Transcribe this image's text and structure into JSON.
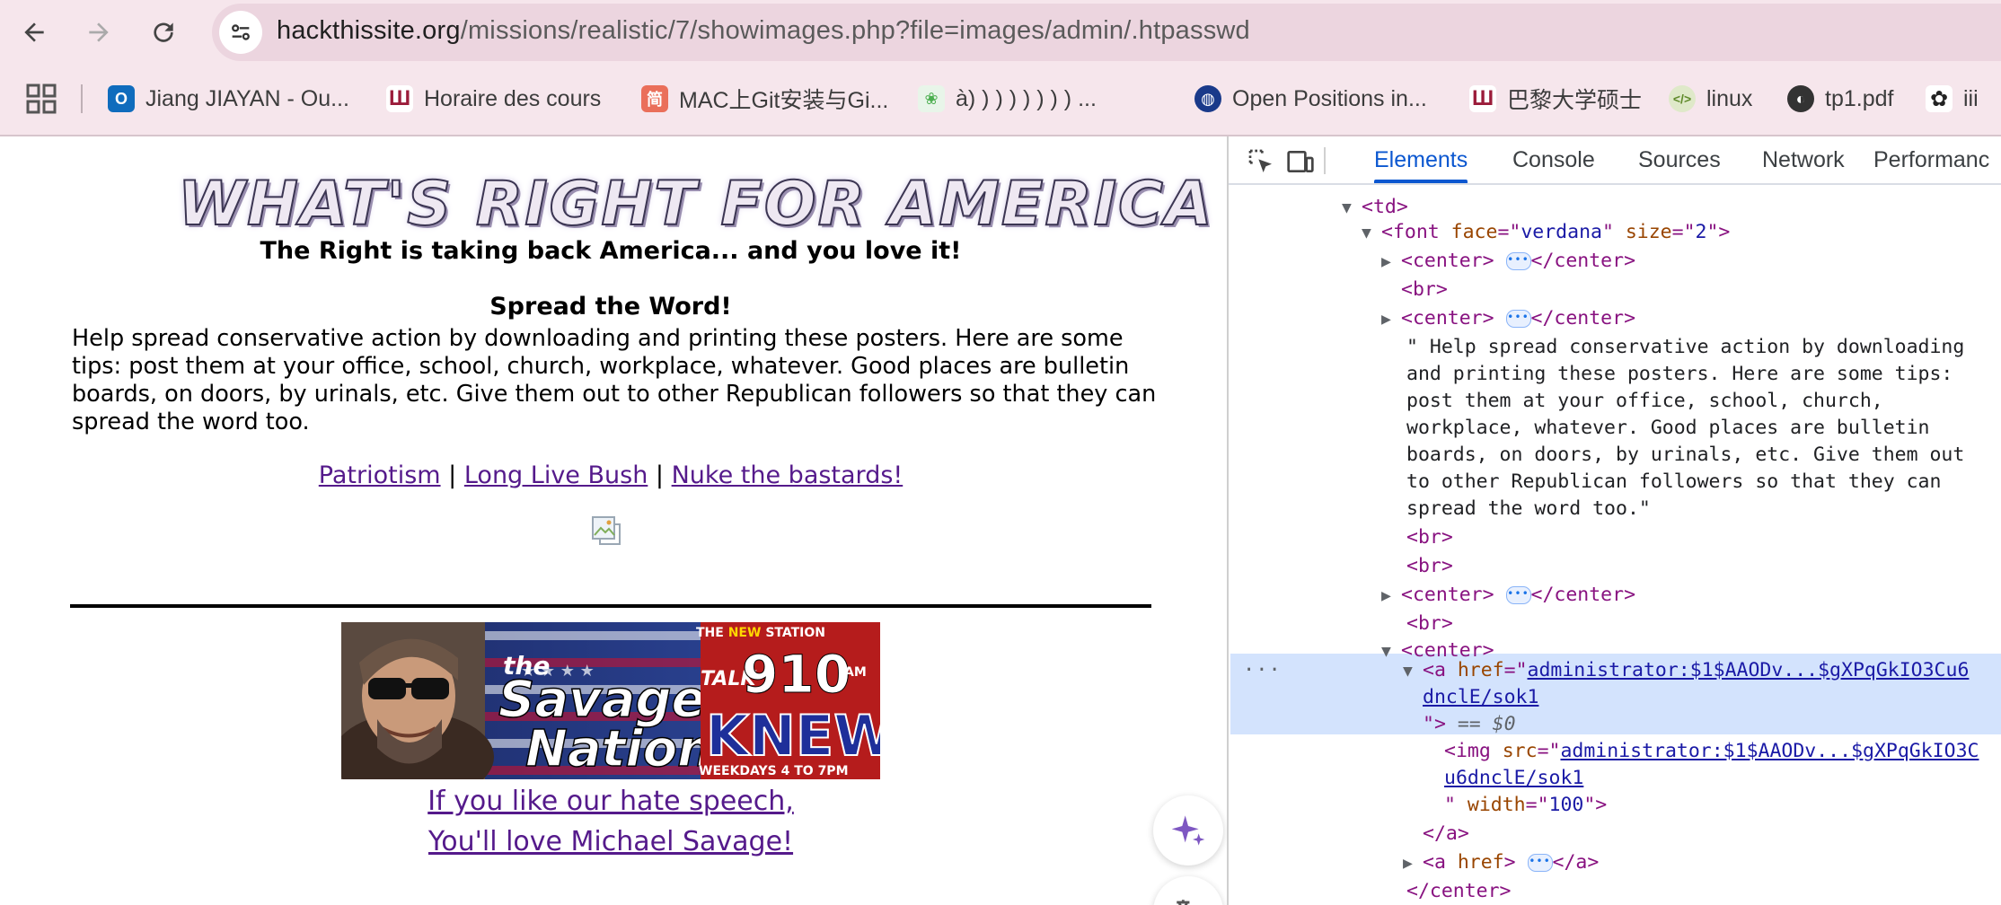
{
  "browser": {
    "url_host": "hackthissite.org",
    "url_path": "/missions/realistic/7/showimages.php?file=images/admin/.htpasswd",
    "bookmarks": [
      {
        "label": "Jiang JIAYAN - Ou...",
        "icon": "outlook-icon",
        "color": "#0f6cbd"
      },
      {
        "label": "Horaire des cours",
        "icon": "university-icon",
        "color": "#9b1c3a"
      },
      {
        "label": "MAC上Git安装与Gi...",
        "icon": "jianshu-icon",
        "color": "#ea6f5a"
      },
      {
        "label": "à) ) ) ) ) ) ) ) ...",
        "icon": "paw-icon",
        "color": "#4caf50"
      },
      {
        "label": "Open Positions in...",
        "icon": "globe-icon",
        "color": "#1a3a8a"
      },
      {
        "label": "巴黎大学硕士",
        "icon": "university-icon",
        "color": "#9b1c3a"
      },
      {
        "label": "linux",
        "icon": "code-icon",
        "color": "#5f8a2a"
      },
      {
        "label": "tp1.pdf",
        "icon": "world-icon",
        "color": "#333333"
      },
      {
        "label": "iii",
        "icon": "openai-icon",
        "color": "#222222"
      }
    ]
  },
  "page": {
    "logo_text": "WHAT'S RIGHT FOR AMERICA",
    "tagline": "The Right is taking back America... and you love it!",
    "heading": "Spread the Word!",
    "paragraph": "Help spread conservative action by downloading and printing these posters. Here are some tips: post them at your office, school, church, workplace, whatever. Good places are bulletin boards, on doors, by urinals, etc. Give them out to other Republican followers so that they can spread the word too.",
    "links": [
      "Patriotism",
      "Long Live Bush",
      "Nuke the bastards!"
    ],
    "link_separator": "|",
    "banner": {
      "line_the": "the",
      "line_savage": "Savage",
      "line_nation": "Nation",
      "the_new_station_prefix": "THE ",
      "the_new_station_new": "NEW",
      "the_new_station_suffix": " STATION",
      "talk": "TALK",
      "freq": "910",
      "am": "AM",
      "knew": "KNEW",
      "weekdays": "WEEKDAYS 4 TO 7PM"
    },
    "savage_link_line1": "If you like our hate speech,",
    "savage_link_line2": "You'll love Michael Savage!"
  },
  "devtools": {
    "tabs": [
      "Elements",
      "Console",
      "Sources",
      "Network",
      "Performanc"
    ],
    "active_tab": "Elements",
    "text_node_lines": [
      "\" Help spread conservative action by downloading",
      "and printing these posters. Here are some tips:",
      "post them at your office, school, church,",
      "workplace, whatever. Good places are bulletin",
      "boards, on doors, by urinals, etc. Give them out",
      "to other Republican followers so that they can",
      "spread the word too.\""
    ],
    "href_line1": "administrator:$1$AAODv...$gXPqGkIO3Cu6",
    "href_line2": "dnclE/sok1",
    "src_line1": "administrator:$1$AAODv...$gXPqGkIO3C",
    "src_line2": "u6dnclE/sok1",
    "width_value": "100",
    "selected_marker": "== $0",
    "font_face": "verdana",
    "font_size": "2",
    "gutter_dots": "..."
  },
  "colors": {
    "chrome_bg": "#f6e6ec",
    "omnibox_bg": "#ecd5df",
    "link_visited": "#551a8b",
    "devtools_accent": "#0b57d0",
    "selected_row": "#d3e3fd"
  }
}
